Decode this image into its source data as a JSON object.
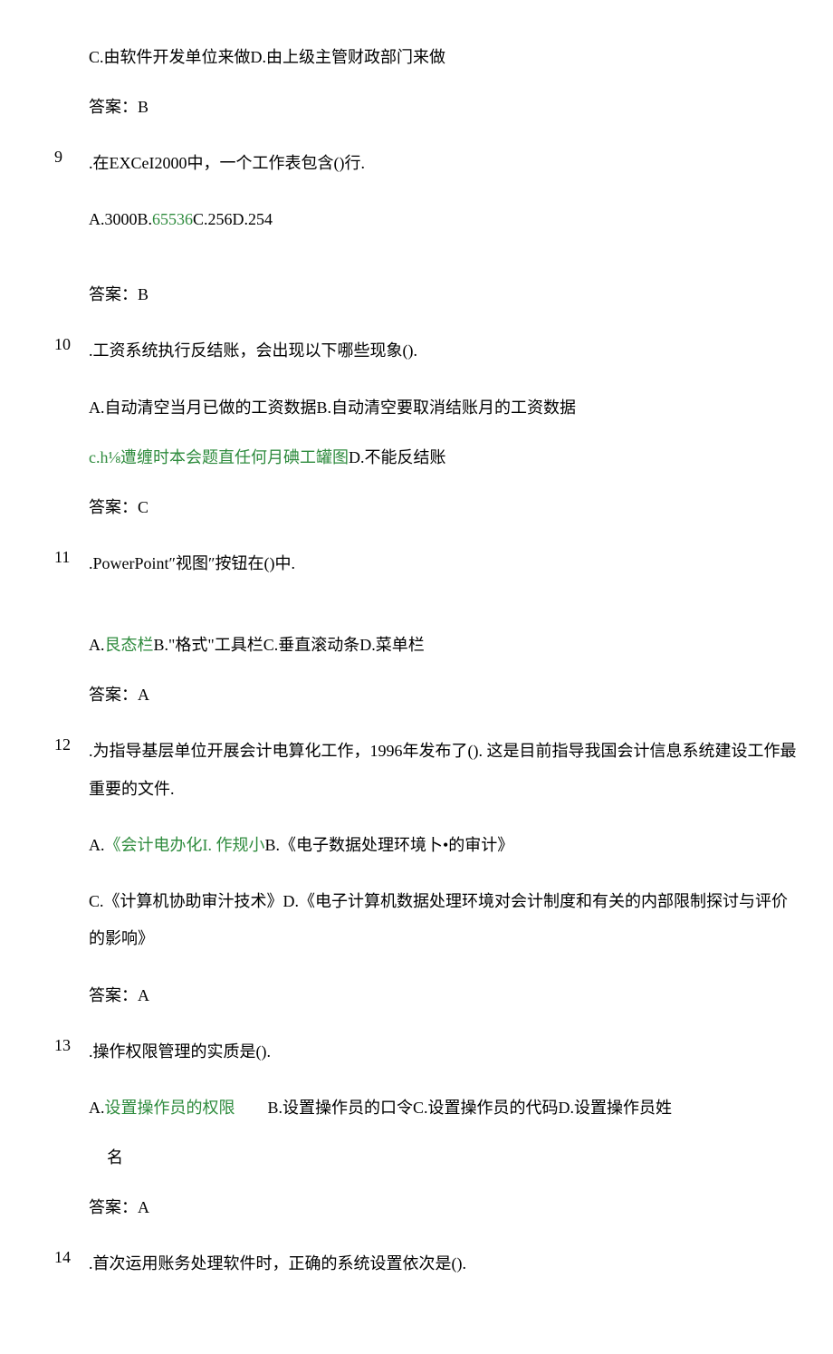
{
  "q8": {
    "opt_cd": "C.由软件开发单位来做D.由上级主管财政部门来做",
    "answer": "答案：B"
  },
  "q9": {
    "num": "9",
    "stem": ".在EXCeI2000中，一个工作表包含()行.",
    "opt_a_pre": "A.3000B.",
    "opt_b": "65536",
    "opt_cd_post": "C.256D.254",
    "answer": "答案：B"
  },
  "q10": {
    "num": "10",
    "stem": ".工资系统执行反结账，会出现以下哪些现象().",
    "opt_ab": "A.自动清空当月已做的工资数据B.自动清空要取消结账月的工资数据",
    "opt_c_pre": "c.h⅛遭缠时本会题直任何月碘工罐图",
    "opt_d": "D.不能反结账",
    "answer": "答案：C"
  },
  "q11": {
    "num": "11",
    "stem": ".PowerPoint″视图″按钮在()中.",
    "opt_a_pre": "A.",
    "opt_a_green": "艮态栏",
    "opt_bcd": "B.\"格式\"工具栏C.垂直滚动条D.菜单栏",
    "answer": "答案：A"
  },
  "q12": {
    "num": "12",
    "stem": ".为指导基层单位开展会计电算化工作，1996年发布了(). 这是目前指导我国会计信息系统建设工作最重要的文件.",
    "opt_a_pre": "A.",
    "opt_a_green": "《会计电办化I. 作规小",
    "opt_b": "B.《电子数据处理环境卜•的审计》",
    "opt_cd": "C.《计算机协助审汁技术》D.《电子计算机数据处理环境对会计制度和有关的内部限制探讨与评价的影响》",
    "answer": "答案：A"
  },
  "q13": {
    "num": "13",
    "stem": ".操作权限管理的实质是().",
    "opt_a_pre": "A.",
    "opt_a_green": "设置操作员的权限",
    "opt_gap": "  ",
    "opt_bcd": "B.设置操作员的口令C.设置操作员的代码D.设置操作员姓",
    "opt_cont": "名",
    "answer": "答案：A"
  },
  "q14": {
    "num": "14",
    "stem": ".首次运用账务处理软件时，正确的系统设置依次是()."
  }
}
